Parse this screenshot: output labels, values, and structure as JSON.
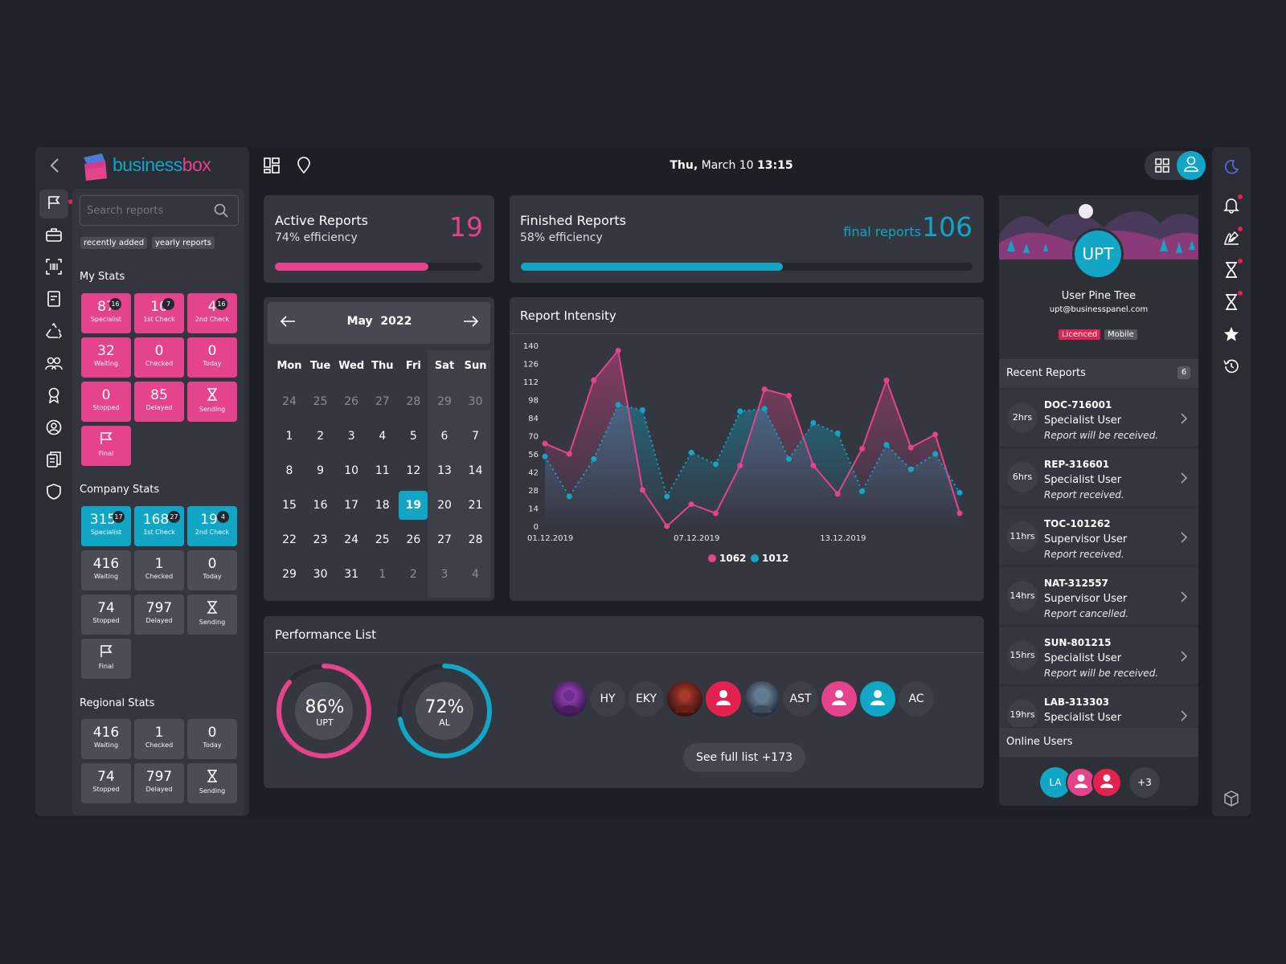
{
  "app": {
    "brand_main": "business",
    "brand_accent": "box"
  },
  "header": {
    "date_prefix": "Thu,",
    "date_rest": "March 10",
    "time": "13:15"
  },
  "sidebar_search": {
    "placeholder": "Search reports",
    "chips": [
      "recently added",
      "yearly reports"
    ]
  },
  "my_stats": {
    "title": "My Stats",
    "tiles": [
      {
        "num": "87",
        "badge": "16",
        "label": "Specialist"
      },
      {
        "num": "10",
        "badge": "7",
        "label": "1st Check"
      },
      {
        "num": "4",
        "badge": "16",
        "label": "2nd Check"
      },
      {
        "num": "32",
        "label": "Waiting"
      },
      {
        "num": "0",
        "label": "Checked"
      },
      {
        "num": "0",
        "label": "Today"
      },
      {
        "num": "0",
        "label": "Stopped"
      },
      {
        "num": "85",
        "label": "Delayed"
      },
      {
        "label": "Sending",
        "icon": "hourglass-icon"
      },
      {
        "label": "Final",
        "icon": "flag-icon"
      }
    ]
  },
  "company_stats": {
    "title": "Company Stats",
    "tiles": [
      {
        "num": "315",
        "badge": "17",
        "label": "Specialist"
      },
      {
        "num": "168",
        "badge": "27",
        "label": "1st Check"
      },
      {
        "num": "19",
        "badge": "4",
        "label": "2nd Check"
      },
      {
        "num": "416",
        "label": "Waiting"
      },
      {
        "num": "1",
        "label": "Checked"
      },
      {
        "num": "0",
        "label": "Today"
      },
      {
        "num": "74",
        "label": "Stopped"
      },
      {
        "num": "797",
        "label": "Delayed"
      },
      {
        "label": "Sending",
        "icon": "hourglass-icon"
      },
      {
        "label": "Final",
        "icon": "flag-icon"
      }
    ]
  },
  "regional_stats": {
    "title": "Regional Stats",
    "tiles": [
      {
        "num": "416",
        "label": "Waiting"
      },
      {
        "num": "1",
        "label": "Checked"
      },
      {
        "num": "0",
        "label": "Today"
      },
      {
        "num": "74",
        "label": "Stopped"
      },
      {
        "num": "797",
        "label": "Delayed"
      },
      {
        "label": "Sending",
        "icon": "hourglass-icon"
      }
    ]
  },
  "active_reports": {
    "title": "Active Reports",
    "subtitle": "74% efficiency",
    "value": "19",
    "progress": 0.74
  },
  "finished_reports": {
    "title": "Finished Reports",
    "subtitle": "58% efficiency",
    "label": "final reports",
    "value": "106",
    "progress": 0.58
  },
  "calendar": {
    "month": "May",
    "year": "2022",
    "weekdays": [
      "Mon",
      "Tue",
      "Wed",
      "Thu",
      "Fri",
      "Sat",
      "Sun"
    ],
    "selected": "19",
    "weeks": [
      [
        "24",
        "25",
        "26",
        "27",
        "28",
        "29",
        "30"
      ],
      [
        "1",
        "2",
        "3",
        "4",
        "5",
        "6",
        "7"
      ],
      [
        "8",
        "9",
        "10",
        "11",
        "12",
        "13",
        "14"
      ],
      [
        "15",
        "16",
        "17",
        "18",
        "19",
        "20",
        "21"
      ],
      [
        "22",
        "23",
        "24",
        "25",
        "26",
        "27",
        "28"
      ],
      [
        "29",
        "30",
        "31",
        "1",
        "2",
        "3",
        "4"
      ]
    ]
  },
  "chart_data": {
    "type": "line",
    "title": "Report Intensity",
    "xlabel": "",
    "ylabel": "",
    "ylim": [
      0,
      140
    ],
    "yticks": [
      0,
      14,
      28,
      42,
      56,
      70,
      84,
      98,
      112,
      126,
      140
    ],
    "x_tick_labels": [
      "01.12.2019",
      "07.12.2019",
      "13.12.2019"
    ],
    "grid": false,
    "legend_position": "bottom-center",
    "series": [
      {
        "name": "1062",
        "color": "#e5438c",
        "values": [
          64,
          56,
          113,
          136,
          28,
          0,
          17,
          10,
          47,
          106,
          101,
          47,
          25,
          60,
          113,
          61,
          71,
          10
        ]
      },
      {
        "name": "1012",
        "color": "#11a6c6",
        "values": [
          54,
          23,
          52,
          94,
          90,
          23,
          57,
          48,
          89,
          91,
          52,
          80,
          72,
          27,
          63,
          44,
          56,
          26
        ]
      }
    ]
  },
  "performance": {
    "title": "Performance List",
    "rings": [
      {
        "pct": "86%",
        "label": "UPT",
        "value": 0.86,
        "color": "#e5438c"
      },
      {
        "pct": "72%",
        "label": "AL",
        "value": 0.72,
        "color": "#11a6c6"
      }
    ],
    "avatars": [
      {
        "type": "photo",
        "color": "#5a2c7a"
      },
      {
        "type": "initials",
        "text": "HY"
      },
      {
        "type": "initials",
        "text": "EKY"
      },
      {
        "type": "photo",
        "color": "#7a2a20"
      },
      {
        "type": "user",
        "bg": "#e5214f"
      },
      {
        "type": "photo",
        "color": "#4a5a6a"
      },
      {
        "type": "initials",
        "text": "AST"
      },
      {
        "type": "user",
        "bg": "#e5438c"
      },
      {
        "type": "user",
        "bg": "#11a6c6"
      },
      {
        "type": "initials",
        "text": "AC"
      }
    ],
    "see_full": "See full list +173"
  },
  "profile": {
    "initials": "UPT",
    "name": "User Pine Tree",
    "email": "upt@businesspanel.com",
    "tags": [
      "Licenced",
      "Mobile"
    ]
  },
  "recent_reports": {
    "title": "Recent Reports",
    "count": "6",
    "items": [
      {
        "time": "2hrs",
        "code": "DOC-716001",
        "role": "Specialist User",
        "msg": "Report will be received."
      },
      {
        "time": "6hrs",
        "code": "REP-316601",
        "role": "Specialist User",
        "msg": "Report received."
      },
      {
        "time": "11hrs",
        "code": "TOC-101262",
        "role": "Supervisor User",
        "msg": "Report received."
      },
      {
        "time": "14hrs",
        "code": "NAT-312557",
        "role": "Supervisor User",
        "msg": "Report cancelled."
      },
      {
        "time": "15hrs",
        "code": "SUN-801215",
        "role": "Specialist User",
        "msg": "Report will be received."
      },
      {
        "time": "19hrs",
        "code": "LAB-313303",
        "role": "Specialist User",
        "msg": ""
      }
    ]
  },
  "online_users": {
    "title": "Online Users",
    "first": "LA",
    "more": "+3"
  },
  "colors": {
    "pink": "#e5438c",
    "cyan": "#11a6c6",
    "red": "#e5214f",
    "bg": "#1f222b",
    "panel": "#343740"
  },
  "icons": {
    "left_nav": [
      "flag-icon",
      "briefcase-icon",
      "barcode-icon",
      "document-icon",
      "recycle-icon",
      "team-icon",
      "award-icon",
      "account-icon",
      "copy-icon",
      "shield-icon"
    ],
    "right_rail": [
      "moon-icon",
      "bell-icon",
      "signature-icon",
      "hourglass-icon",
      "hourglass-icon",
      "star-icon",
      "history-icon",
      "cube-icon"
    ]
  }
}
